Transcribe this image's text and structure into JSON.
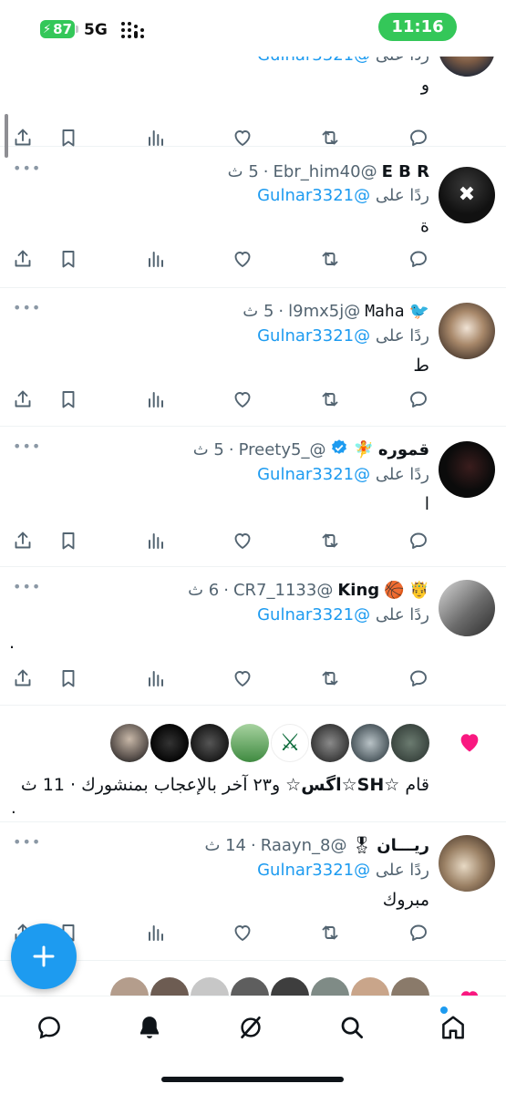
{
  "status_bar": {
    "battery": "87",
    "network": "5G",
    "time": "11:16"
  },
  "reply_prefix": "ردًا على",
  "reply_mention": "@Gulnar3321",
  "tweets": [
    {
      "name": "",
      "handle": "",
      "time": "",
      "reply_prefix": "ردًا على",
      "reply_mention": "@Gulnar3321",
      "text": "و"
    },
    {
      "name": "E B R",
      "handle": "@Ebr_him40",
      "time": "5 ث",
      "reply_prefix": "ردًا على",
      "reply_mention": "@Gulnar3321",
      "text": "ة"
    },
    {
      "name": "Maha",
      "name_emoji": "🐦",
      "handle": "@l9mx5j",
      "time": "5 ث",
      "reply_prefix": "ردًا على",
      "reply_mention": "@Gulnar3321",
      "text": "ط"
    },
    {
      "name": "قموره",
      "name_emoji": "🧚",
      "verified": true,
      "handle": "@_Preety5",
      "time": "5 ث",
      "reply_prefix": "ردًا على",
      "reply_mention": "@Gulnar3321",
      "text": "ا"
    },
    {
      "name": "King",
      "name_emoji_before": "🤴",
      "name_emoji_after": "🏀",
      "handle": "@CR7_1133",
      "time": "6 ث",
      "reply_prefix": "ردًا على",
      "reply_mention": "@Gulnar3321",
      "text": "."
    },
    {
      "name": "ريـــان",
      "name_emoji": "🎖",
      "handle": "@Raayn_8",
      "time": "14 ث",
      "reply_prefix": "ردًا على",
      "reply_mention": "@Gulnar3321",
      "text": "مبروك"
    }
  ],
  "like_notification": {
    "text_prefix": "قام",
    "user": "☆SH☆اگس☆",
    "text_rest": "و٢٣ آخر بالإعجاب بمنشورك · 11 ث",
    "trailing": "."
  },
  "colors": {
    "accent": "#1d9bf0",
    "like": "#f91880",
    "secondary_text": "#536471",
    "status_green": "#34c759"
  },
  "icons": {
    "actions": [
      "reply-icon",
      "retweet-icon",
      "like-icon",
      "views-icon",
      "bookmark-icon",
      "share-icon"
    ],
    "tabs": [
      "home-icon",
      "search-icon",
      "grok-icon",
      "notifications-icon",
      "messages-icon"
    ],
    "fab": "plus-icon"
  }
}
